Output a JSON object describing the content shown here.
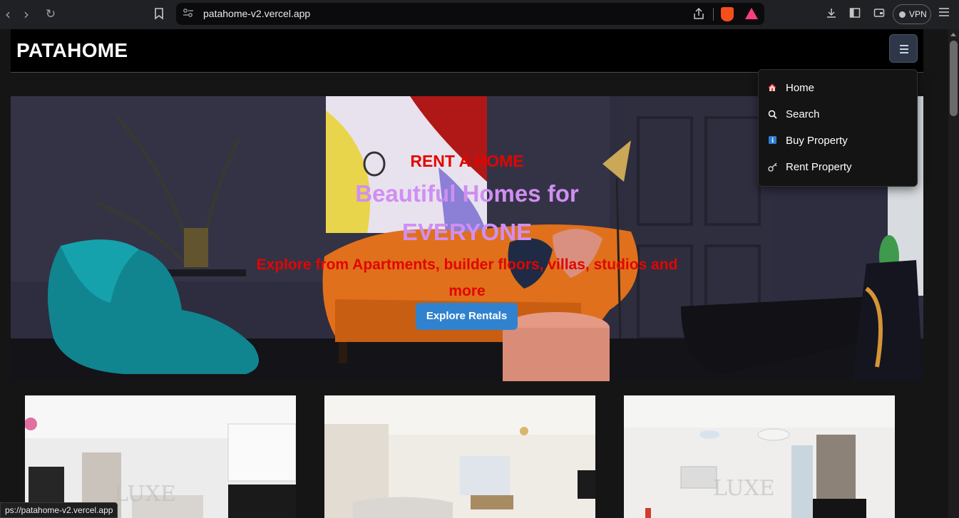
{
  "browser": {
    "url": "patahome-v2.vercel.app",
    "vpn_label": "VPN",
    "status_url": "ps://patahome-v2.vercel.app"
  },
  "navbar": {
    "brand": "PATAHOME"
  },
  "menu": {
    "items": [
      {
        "label": "Home",
        "icon": "house-icon"
      },
      {
        "label": "Search",
        "icon": "search-icon"
      },
      {
        "label": "Buy Property",
        "icon": "info-icon"
      },
      {
        "label": "Rent Property",
        "icon": "key-icon"
      }
    ]
  },
  "hero": {
    "subtitle": "RENT A HOME",
    "title": "Beautiful Homes for EVERYONE",
    "description": "Explore from Apartments, builder floors, villas, studios and more",
    "button": "Explore Rentals"
  },
  "colors": {
    "accent": "#3182ce",
    "subtitle": "#e10600",
    "title": "#cf8ff2"
  }
}
